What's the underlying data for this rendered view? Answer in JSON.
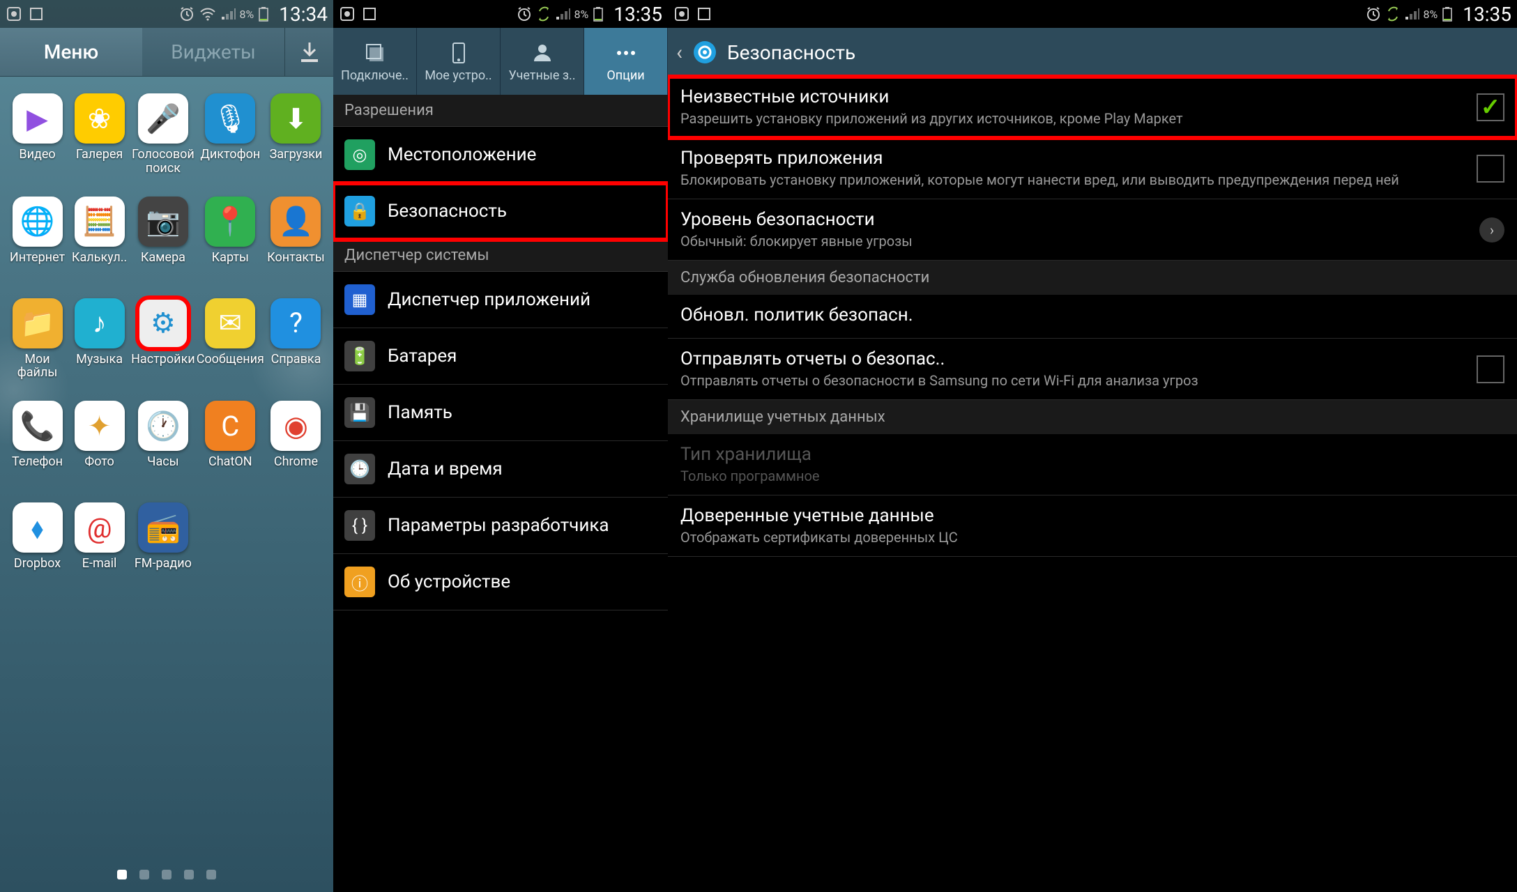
{
  "phone1": {
    "statusbar": {
      "battery_pct": "8%",
      "time": "13:34"
    },
    "tabs": {
      "menu": "Меню",
      "widgets": "Виджеты"
    },
    "apps": [
      {
        "name": "video",
        "label": "Видео",
        "bg": "#fff",
        "glyph": "▶",
        "gc": "#9050e0"
      },
      {
        "name": "gallery",
        "label": "Галерея",
        "bg": "#ffcc00",
        "glyph": "❀",
        "gc": "#fff"
      },
      {
        "name": "voice-search",
        "label": "Голосовой поиск",
        "bg": "#fff",
        "glyph": "🎤",
        "gc": "#e03030"
      },
      {
        "name": "recorder",
        "label": "Диктофон",
        "bg": "#2090d0",
        "glyph": "🎙",
        "gc": "#fff"
      },
      {
        "name": "downloads",
        "label": "Загрузки",
        "bg": "#60b020",
        "glyph": "⬇",
        "gc": "#fff"
      },
      {
        "name": "internet",
        "label": "Интернет",
        "bg": "#fff",
        "glyph": "🌐",
        "gc": "#4090d0"
      },
      {
        "name": "calculator",
        "label": "Калькул..",
        "bg": "#fff",
        "glyph": "🧮",
        "gc": "#555"
      },
      {
        "name": "camera",
        "label": "Камера",
        "bg": "#444",
        "glyph": "📷",
        "gc": "#fff"
      },
      {
        "name": "maps",
        "label": "Карты",
        "bg": "#30b050",
        "glyph": "📍",
        "gc": "#e04030"
      },
      {
        "name": "contacts",
        "label": "Контакты",
        "bg": "#f09030",
        "glyph": "👤",
        "gc": "#fff"
      },
      {
        "name": "myfiles",
        "label": "Мои файлы",
        "bg": "#f0b030",
        "glyph": "📁",
        "gc": "#fff"
      },
      {
        "name": "music",
        "label": "Музыка",
        "bg": "#20b0d0",
        "glyph": "♪",
        "gc": "#fff"
      },
      {
        "name": "settings",
        "label": "Настройки",
        "bg": "#eee",
        "glyph": "⚙",
        "gc": "#2090d0",
        "highlight": true
      },
      {
        "name": "messages",
        "label": "Сообщения",
        "bg": "#f0d030",
        "glyph": "✉",
        "gc": "#fff"
      },
      {
        "name": "help",
        "label": "Справка",
        "bg": "#2090e0",
        "glyph": "?",
        "gc": "#fff"
      },
      {
        "name": "phone",
        "label": "Телефон",
        "bg": "#fff",
        "glyph": "📞",
        "gc": "#30b050"
      },
      {
        "name": "photos",
        "label": "Фото",
        "bg": "#fff",
        "glyph": "✦",
        "gc": "#e0a030"
      },
      {
        "name": "clock",
        "label": "Часы",
        "bg": "#fff",
        "glyph": "🕐",
        "gc": "#555"
      },
      {
        "name": "chaton",
        "label": "ChatON",
        "bg": "#f08020",
        "glyph": "C",
        "gc": "#fff"
      },
      {
        "name": "chrome",
        "label": "Chrome",
        "bg": "#fff",
        "glyph": "◉",
        "gc": "#e04030"
      },
      {
        "name": "dropbox",
        "label": "Dropbox",
        "bg": "#fff",
        "glyph": "⬧",
        "gc": "#2090e0"
      },
      {
        "name": "email",
        "label": "E-mail",
        "bg": "#fff",
        "glyph": "@",
        "gc": "#e03030"
      },
      {
        "name": "fmradio",
        "label": "FM-радио",
        "bg": "#3060a0",
        "glyph": "📻",
        "gc": "#fff"
      }
    ],
    "page_count": 5,
    "active_page": 0
  },
  "phone2": {
    "statusbar": {
      "battery_pct": "8%",
      "time": "13:35"
    },
    "tabs": [
      {
        "name": "connections",
        "label": "Подключе.."
      },
      {
        "name": "device",
        "label": "Мое устро.."
      },
      {
        "name": "accounts",
        "label": "Учетные з.."
      },
      {
        "name": "options",
        "label": "Опции",
        "active": true
      }
    ],
    "sections": [
      {
        "header": "Разрешения",
        "items": [
          {
            "name": "location",
            "label": "Местоположение",
            "icon_bg": "#20a060",
            "glyph": "◎"
          },
          {
            "name": "security",
            "label": "Безопасность",
            "icon_bg": "#20a0e0",
            "glyph": "🔒",
            "highlight": true
          }
        ]
      },
      {
        "header": "Диспетчер системы",
        "items": [
          {
            "name": "apps-dispatcher",
            "label": "Диспетчер приложений",
            "icon_bg": "#2060d0",
            "glyph": "▦"
          },
          {
            "name": "battery",
            "label": "Батарея",
            "icon_bg": "#404040",
            "glyph": "🔋"
          },
          {
            "name": "storage",
            "label": "Память",
            "icon_bg": "#404040",
            "glyph": "💾"
          },
          {
            "name": "datetime",
            "label": "Дата и время",
            "icon_bg": "#404040",
            "glyph": "🕒"
          },
          {
            "name": "developer",
            "label": "Параметры разработчика",
            "icon_bg": "#404040",
            "glyph": "{ }"
          },
          {
            "name": "about",
            "label": "Об устройстве",
            "icon_bg": "#f0a020",
            "glyph": "ⓘ"
          }
        ]
      }
    ]
  },
  "phone3": {
    "statusbar": {
      "battery_pct": "8%",
      "time": "13:35"
    },
    "header": "Безопасность",
    "items": [
      {
        "name": "unknown-sources",
        "title": "Неизвестные источники",
        "sub": "Разрешить установку приложений из других источников, кроме Play Маркет",
        "checkbox": true,
        "checked": true,
        "highlight": true
      },
      {
        "name": "verify-apps",
        "title": "Проверять приложения",
        "sub": "Блокировать установку приложений, которые могут нанести вред, или выводить предупреждения перед ней",
        "checkbox": true,
        "checked": false
      },
      {
        "name": "security-level",
        "title": "Уровень безопасности",
        "sub": "Обычный: блокирует явные угрозы",
        "chevron": true
      },
      {
        "section": "Служба обновления безопасности"
      },
      {
        "name": "update-policies",
        "title": "Обновл. политик безопасн."
      },
      {
        "name": "send-reports",
        "title": "Отправлять отчеты о безопас..",
        "sub": "Отправлять отчеты о безопасности в Samsung по сети Wi-Fi для анализа угроз",
        "checkbox": true,
        "checked": false
      },
      {
        "section": "Хранилище учетных данных"
      },
      {
        "name": "storage-type",
        "title": "Тип хранилища",
        "sub": "Только программное",
        "disabled": true
      },
      {
        "name": "trusted-creds",
        "title": "Доверенные учетные данные",
        "sub": "Отображать сертификаты доверенных ЦС"
      }
    ]
  }
}
